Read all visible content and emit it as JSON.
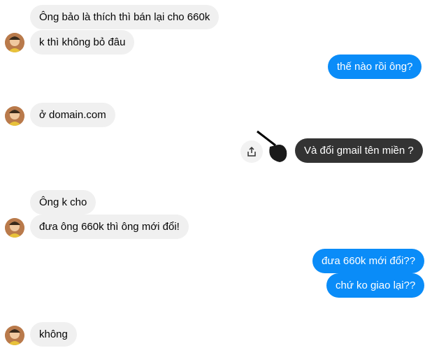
{
  "messages": [
    {
      "id": "m1",
      "side": "in",
      "text": "Ông bảo là thích thì bán lại cho 660k"
    },
    {
      "id": "m2",
      "side": "in",
      "text": "k thì không bỏ đâu"
    },
    {
      "id": "m3",
      "side": "out",
      "text": "thế nào rồi ông?"
    },
    {
      "id": "m4",
      "side": "in",
      "text": "ở domain.com"
    },
    {
      "id": "m5",
      "side": "out",
      "text": "Và đổi gmail tên miền ?"
    },
    {
      "id": "m6",
      "side": "in",
      "text": "Ông k cho"
    },
    {
      "id": "m7",
      "side": "in",
      "text": "đưa ông 660k thì ông mới đổi!"
    },
    {
      "id": "m8",
      "side": "out",
      "text": "đưa 660k mới đổi??"
    },
    {
      "id": "m9",
      "side": "out",
      "text": "chứ ko giao lại??"
    },
    {
      "id": "m10",
      "side": "in",
      "text": "không"
    }
  ],
  "colors": {
    "incoming_bg": "#f0f0f0",
    "outgoing_bg": "#0a8cf8",
    "highlighted_bg": "#333333"
  },
  "icons": {
    "share": "share-icon",
    "avatar": "avatar"
  }
}
